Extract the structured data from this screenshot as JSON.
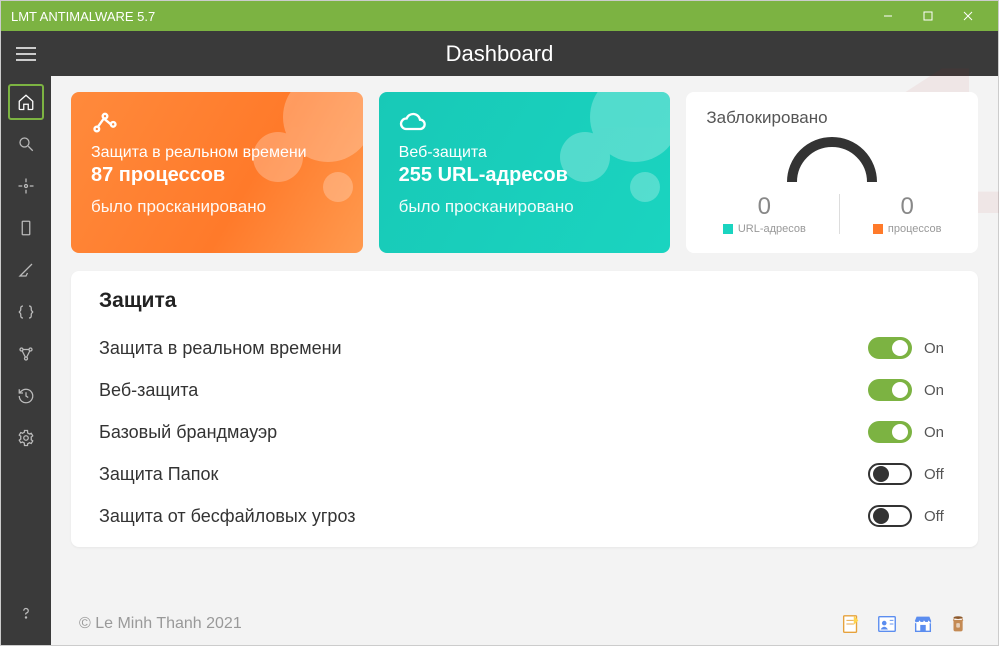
{
  "window": {
    "title": "LMT ANTIMALWARE 5.7"
  },
  "header": {
    "title": "Dashboard"
  },
  "cards": {
    "realtime": {
      "title": "Защита в реальном времени",
      "value": "87 процессов",
      "sub": "было просканировано"
    },
    "web": {
      "title": "Веб-защита",
      "value": "255 URL-адресов",
      "sub": "было просканировано"
    },
    "blocked": {
      "title": "Заблокировано",
      "url_count": "0",
      "url_label": "URL-адресов",
      "proc_count": "0",
      "proc_label": "процессов"
    }
  },
  "protection": {
    "heading": "Защита",
    "items": [
      {
        "label": "Защита в реальном времени",
        "state": "On",
        "on": true
      },
      {
        "label": "Веб-защита",
        "state": "On",
        "on": true
      },
      {
        "label": "Базовый брандмауэр",
        "state": "On",
        "on": true
      },
      {
        "label": "Защита Папок",
        "state": "Off",
        "on": false
      },
      {
        "label": "Защита от бесфайловых угроз",
        "state": "Off",
        "on": false
      }
    ]
  },
  "footer": {
    "copyright": "© Le Minh Thanh 2021"
  },
  "colors": {
    "accent": "#7cb342",
    "orange": "#ff7a2a",
    "teal": "#1ad4c0"
  }
}
